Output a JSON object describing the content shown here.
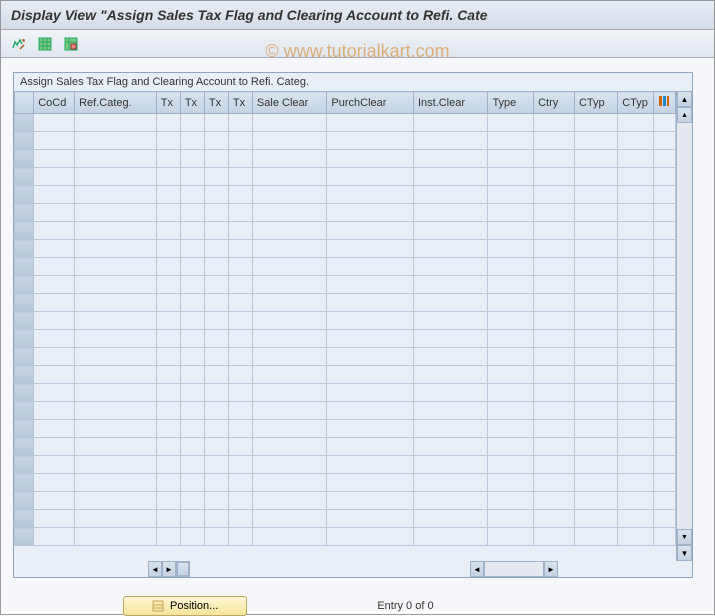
{
  "title": "Display View \"Assign Sales Tax Flag and Clearing Account to Refi. Cate",
  "watermark": "© www.tutorialkart.com",
  "grid": {
    "caption": "Assign Sales Tax Flag and Clearing Account to Refi. Categ.",
    "columns": [
      "CoCd",
      "Ref.Categ.",
      "Tx",
      "Tx",
      "Tx",
      "Tx",
      "Sale Clear",
      "PurchClear",
      "Inst.Clear",
      "Type",
      "Ctry",
      "CTyp",
      "CTyp"
    ]
  },
  "footer": {
    "position_label": "Position...",
    "entry_status": "Entry 0 of 0"
  }
}
